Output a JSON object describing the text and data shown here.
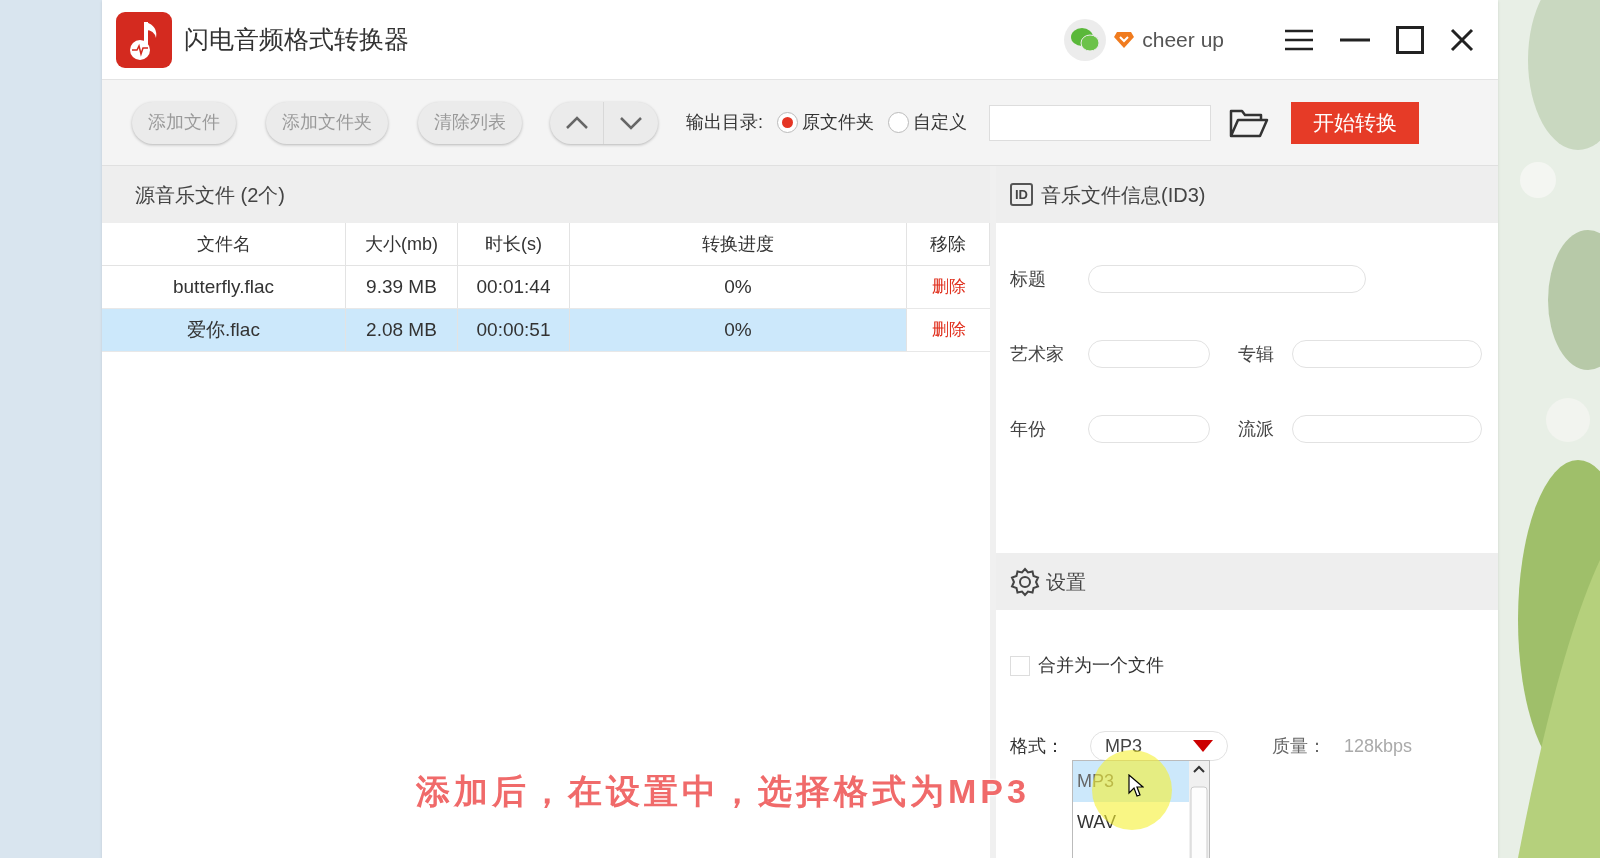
{
  "window": {
    "title": "闪电音频格式转换器",
    "user": "cheer up"
  },
  "toolbar": {
    "buttons": [
      "添加文件",
      "添加文件夹",
      "清除列表"
    ],
    "output_label": "输出目录:",
    "output_options": [
      {
        "label": "原文件夹",
        "selected": true
      },
      {
        "label": "自定义",
        "selected": false
      }
    ],
    "start_button": "开始转换"
  },
  "file_list": {
    "title": "源音乐文件 (2个)",
    "columns": [
      "文件名",
      "大小(mb)",
      "时长(s)",
      "转换进度",
      "移除"
    ],
    "rows": [
      {
        "cells": [
          "butterfly.flac",
          "9.39 MB",
          "00:01:44",
          "0%"
        ],
        "action": "删除",
        "selected": false
      },
      {
        "cells": [
          "爱你.flac",
          "2.08 MB",
          "00:00:51",
          "0%"
        ],
        "action": "删除",
        "selected": true
      }
    ]
  },
  "id3": {
    "title": "音乐文件信息(ID3)",
    "badge": "ID",
    "fields": [
      "标题",
      "艺术家",
      "专辑",
      "年份",
      "流派"
    ]
  },
  "settings": {
    "title": "设置",
    "merge": {
      "label": "合并为一个文件",
      "checked": false
    },
    "format_label": "格式：",
    "format_value": "MP3",
    "quality_label": "质量：",
    "quality_value": "128kbps",
    "format_options": [
      {
        "label": "MP3",
        "selected": true
      },
      {
        "label": "WAV",
        "selected": false
      }
    ]
  },
  "caption": "添加后，在设置中，选择格式为MP3"
}
